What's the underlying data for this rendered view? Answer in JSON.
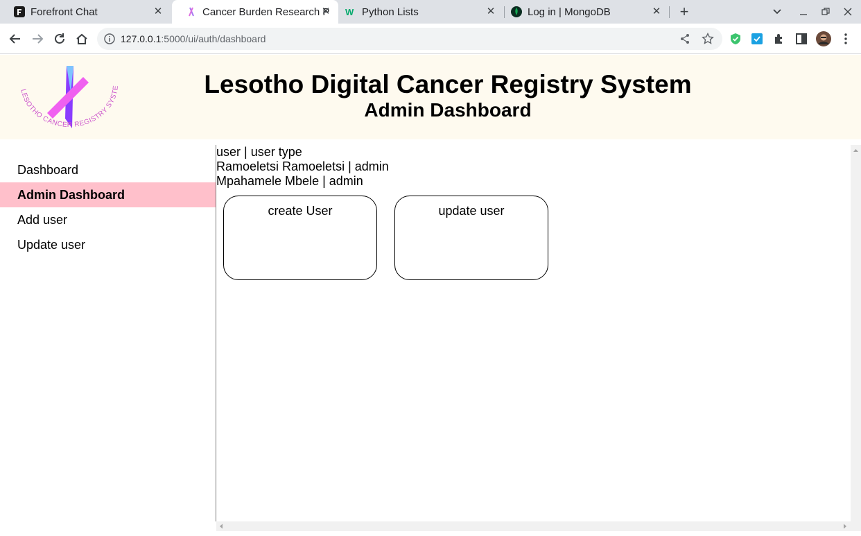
{
  "browser": {
    "tabs": [
      {
        "title": "Forefront Chat",
        "active": false
      },
      {
        "title": "Cancer Burden Research P",
        "active": true
      },
      {
        "title": "Python Lists",
        "active": false
      },
      {
        "title": "Log in | MongoDB",
        "active": false
      }
    ],
    "url_host": "127.0.0.1",
    "url_path": ":5000/ui/auth/dashboard"
  },
  "header": {
    "logo_text": "LESOTHO CANCER REGISTRY SYSTEM",
    "title": "Lesotho Digital Cancer Registry System",
    "subtitle": "Admin Dashboard"
  },
  "sidebar": {
    "items": [
      {
        "label": "Dashboard",
        "active": false
      },
      {
        "label": "Admin Dashboard",
        "active": true
      },
      {
        "label": "Add user",
        "active": false
      },
      {
        "label": "Update user",
        "active": false
      }
    ]
  },
  "main": {
    "table_header": "user | user type",
    "users": [
      "Ramoeletsi Ramoeletsi | admin",
      "Mpahamele Mbele | admin"
    ],
    "cards": [
      {
        "label": "create User"
      },
      {
        "label": "update user"
      }
    ]
  },
  "colors": {
    "header_bg": "#fefaef",
    "active_nav_bg": "#ffc0cb",
    "tabstrip_bg": "#dee1e6"
  }
}
